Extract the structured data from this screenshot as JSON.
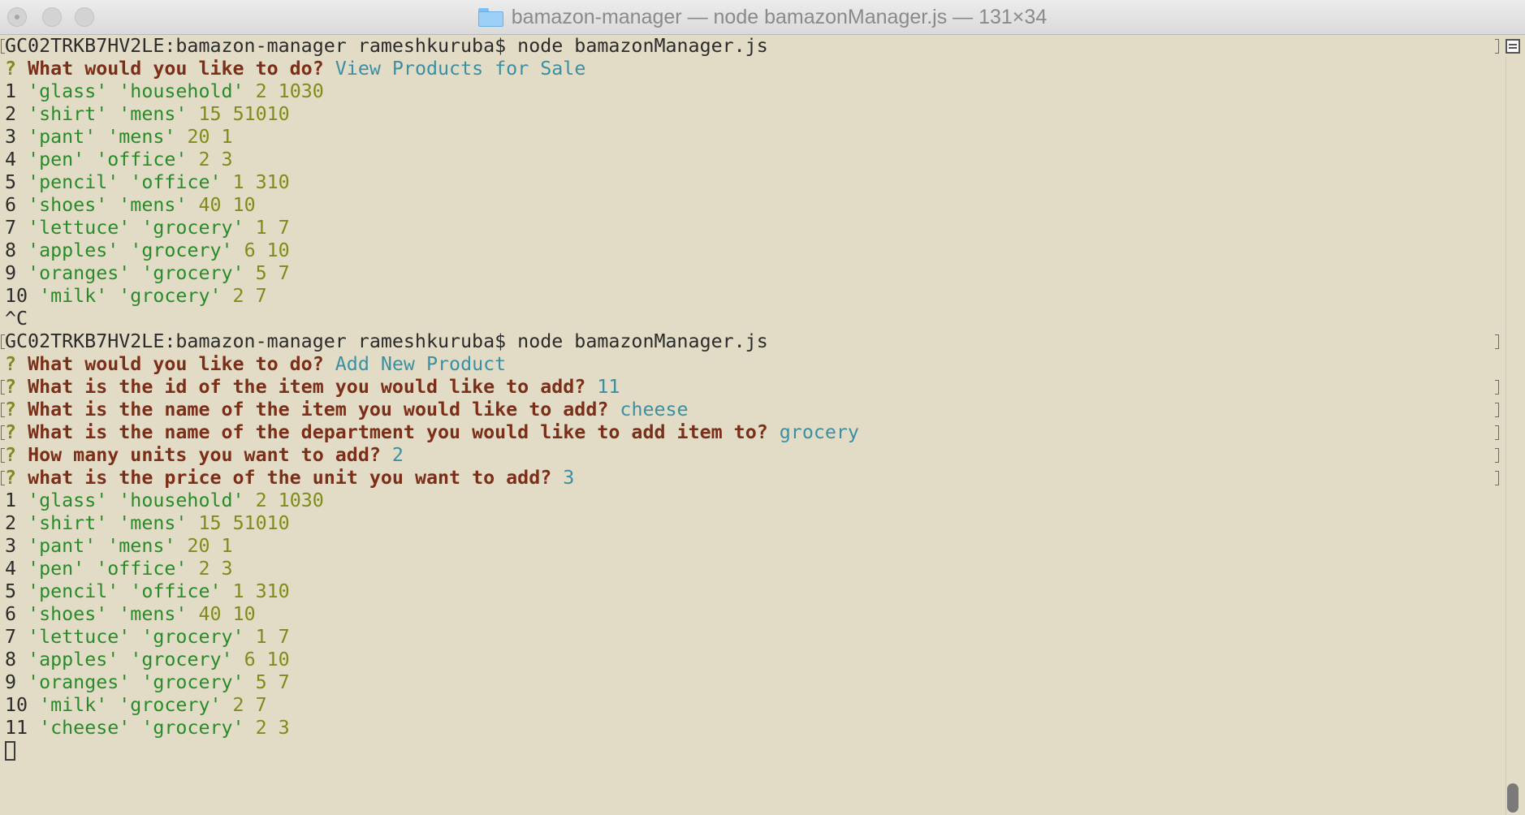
{
  "window": {
    "title": "bamazon-manager — node bamazonManager.js — 131×34"
  },
  "session1": {
    "prompt_command": "GC02TRKB7HV2LE:bamazon-manager rameshkuruba$ node bamazonManager.js",
    "q_mark": "?",
    "question": "What would you like to do?",
    "answer": "View Products for Sale",
    "products": [
      {
        "id": "1",
        "name": "'glass'",
        "dept": "'household'",
        "price": "2",
        "qty": "1030"
      },
      {
        "id": "2",
        "name": "'shirt'",
        "dept": "'mens'",
        "price": "15",
        "qty": "51010"
      },
      {
        "id": "3",
        "name": "'pant'",
        "dept": "'mens'",
        "price": "20",
        "qty": "1"
      },
      {
        "id": "4",
        "name": "'pen'",
        "dept": "'office'",
        "price": "2",
        "qty": "3"
      },
      {
        "id": "5",
        "name": "'pencil'",
        "dept": "'office'",
        "price": "1",
        "qty": "310"
      },
      {
        "id": "6",
        "name": "'shoes'",
        "dept": "'mens'",
        "price": "40",
        "qty": "10"
      },
      {
        "id": "7",
        "name": "'lettuce'",
        "dept": "'grocery'",
        "price": "1",
        "qty": "7"
      },
      {
        "id": "8",
        "name": "'apples'",
        "dept": "'grocery'",
        "price": "6",
        "qty": "10"
      },
      {
        "id": "9",
        "name": "'oranges'",
        "dept": "'grocery'",
        "price": "5",
        "qty": "7"
      },
      {
        "id": "10",
        "name": "'milk'",
        "dept": "'grocery'",
        "price": "2",
        "qty": "7"
      }
    ],
    "interrupt": "^C"
  },
  "session2": {
    "prompt_command": "GC02TRKB7HV2LE:bamazon-manager rameshkuruba$ node bamazonManager.js",
    "questions": [
      {
        "mark": "?",
        "text": "What would you like to do?",
        "answer": "Add New Product"
      },
      {
        "mark": "?",
        "text": "What is the id of the item you would like to add?",
        "answer": "11"
      },
      {
        "mark": "?",
        "text": "What is the name of the item you would like to add?",
        "answer": "cheese"
      },
      {
        "mark": "?",
        "text": "What is the name of the department you would like to add item to?",
        "answer": "grocery"
      },
      {
        "mark": "?",
        "text": "How many units you want to add?",
        "answer": "2"
      },
      {
        "mark": "?",
        "text": "what is the price of the unit you want to add?",
        "answer": "3"
      }
    ],
    "products": [
      {
        "id": "1",
        "name": "'glass'",
        "dept": "'household'",
        "price": "2",
        "qty": "1030"
      },
      {
        "id": "2",
        "name": "'shirt'",
        "dept": "'mens'",
        "price": "15",
        "qty": "51010"
      },
      {
        "id": "3",
        "name": "'pant'",
        "dept": "'mens'",
        "price": "20",
        "qty": "1"
      },
      {
        "id": "4",
        "name": "'pen'",
        "dept": "'office'",
        "price": "2",
        "qty": "3"
      },
      {
        "id": "5",
        "name": "'pencil'",
        "dept": "'office'",
        "price": "1",
        "qty": "310"
      },
      {
        "id": "6",
        "name": "'shoes'",
        "dept": "'mens'",
        "price": "40",
        "qty": "10"
      },
      {
        "id": "7",
        "name": "'lettuce'",
        "dept": "'grocery'",
        "price": "1",
        "qty": "7"
      },
      {
        "id": "8",
        "name": "'apples'",
        "dept": "'grocery'",
        "price": "6",
        "qty": "10"
      },
      {
        "id": "9",
        "name": "'oranges'",
        "dept": "'grocery'",
        "price": "5",
        "qty": "7"
      },
      {
        "id": "10",
        "name": "'milk'",
        "dept": "'grocery'",
        "price": "2",
        "qty": "7"
      },
      {
        "id": "11",
        "name": "'cheese'",
        "dept": "'grocery'",
        "price": "2",
        "qty": "3"
      }
    ]
  },
  "colors": {
    "background": "#e2dcc6",
    "question": "#7b2e18",
    "answer": "#3b8fa3",
    "string": "#2a8a2a",
    "number": "#7f8c1c"
  }
}
